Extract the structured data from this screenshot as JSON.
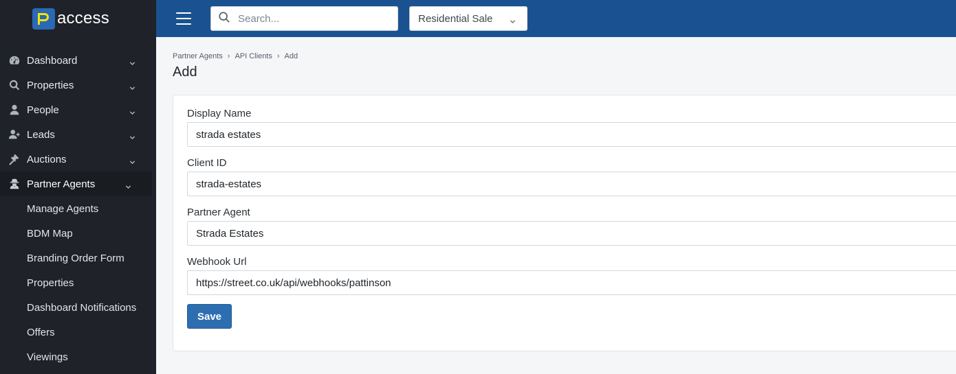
{
  "brand": {
    "name": "access",
    "logo_letter": "P"
  },
  "topbar": {
    "search_placeholder": "Search...",
    "sale_type_selected": "Residential Sale"
  },
  "sidebar": {
    "items": [
      {
        "label": "Dashboard",
        "icon": "tachometer-icon"
      },
      {
        "label": "Properties",
        "icon": "search-icon"
      },
      {
        "label": "People",
        "icon": "user-icon"
      },
      {
        "label": "Leads",
        "icon": "user-plus-icon"
      },
      {
        "label": "Auctions",
        "icon": "gavel-icon"
      },
      {
        "label": "Partner Agents",
        "icon": "user-secret-icon",
        "active": true
      }
    ],
    "sub_items": [
      {
        "label": "Manage Agents"
      },
      {
        "label": "BDM Map"
      },
      {
        "label": "Branding Order Form"
      },
      {
        "label": "Properties"
      },
      {
        "label": "Dashboard Notifications"
      },
      {
        "label": "Offers"
      },
      {
        "label": "Viewings"
      }
    ]
  },
  "breadcrumb": [
    "Partner Agents",
    "API Clients",
    "Add"
  ],
  "page_title": "Add",
  "form": {
    "display_name": {
      "label": "Display Name",
      "value": "strada estates"
    },
    "client_id": {
      "label": "Client ID",
      "value": "strada-estates"
    },
    "partner_agent": {
      "label": "Partner Agent",
      "value": "Strada Estates"
    },
    "webhook_url": {
      "label": "Webhook Url",
      "value": "https://street.co.uk/api/webhooks/pattinson"
    },
    "save_label": "Save"
  },
  "colors": {
    "sidebar_bg": "#1f2329",
    "topbar_bg": "#1a5190",
    "logo_blue": "#2a69b5",
    "logo_yellow": "#f2e600",
    "save_button": "#2d6eb1"
  }
}
